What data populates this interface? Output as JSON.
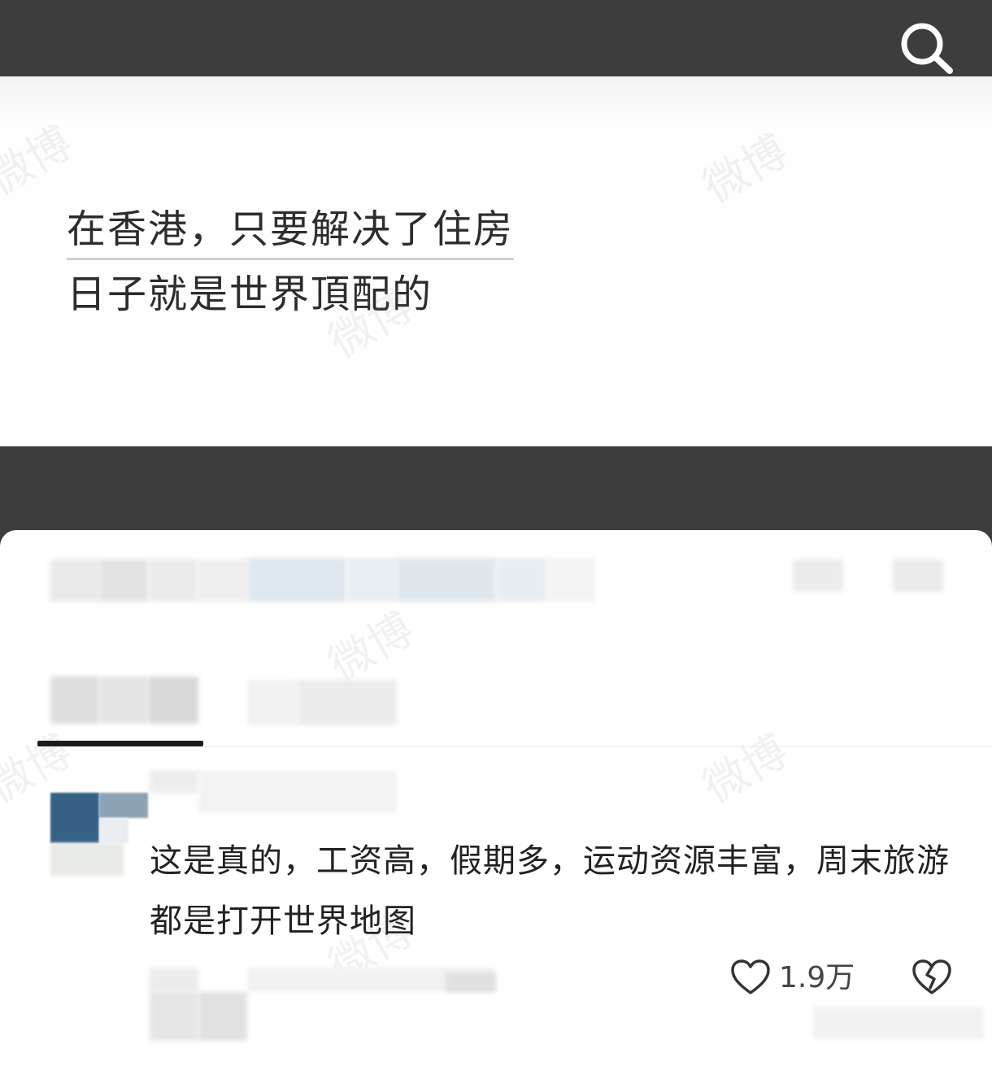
{
  "video": {
    "caption_line1": "在香港，只要解决了住房",
    "caption_line2": "日子就是世界頂配的"
  },
  "comment": {
    "text": "这是真的，工资高，假期多，运动资源丰富，周末旅游都是打开世界地图",
    "like_count": "1.9万"
  },
  "watermark": "微博",
  "icons": {
    "search": "search-icon",
    "like": "heart-icon",
    "dislike": "broken-heart-icon"
  },
  "colors": {
    "header_bg": "#3d3d3d",
    "text_primary": "#2d2d2d",
    "tab_active": "#1c1c1c"
  }
}
